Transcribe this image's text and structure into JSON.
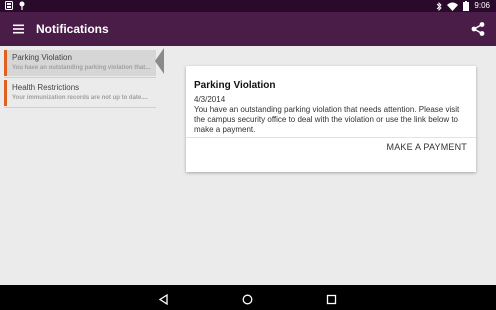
{
  "status_bar": {
    "time": "9:06"
  },
  "app_bar": {
    "title": "Notifications"
  },
  "notifications": [
    {
      "title": "Parking Violation",
      "preview": "You have an outstanding parking violation that..."
    },
    {
      "title": "Health Restrictions",
      "preview": "Your immunization records are not up to date...."
    }
  ],
  "detail": {
    "title": "Parking Violation",
    "date": "4/3/2014",
    "body": "You have an outstanding parking violation that needs attention. Please visit the campus security office to deal with the violation or use the link below to make a payment.",
    "action_label": "MAKE A PAYMENT"
  },
  "colors": {
    "accent": "#e06020",
    "app_bar": "#4a1c48",
    "status_bar": "#2a0a2a"
  }
}
